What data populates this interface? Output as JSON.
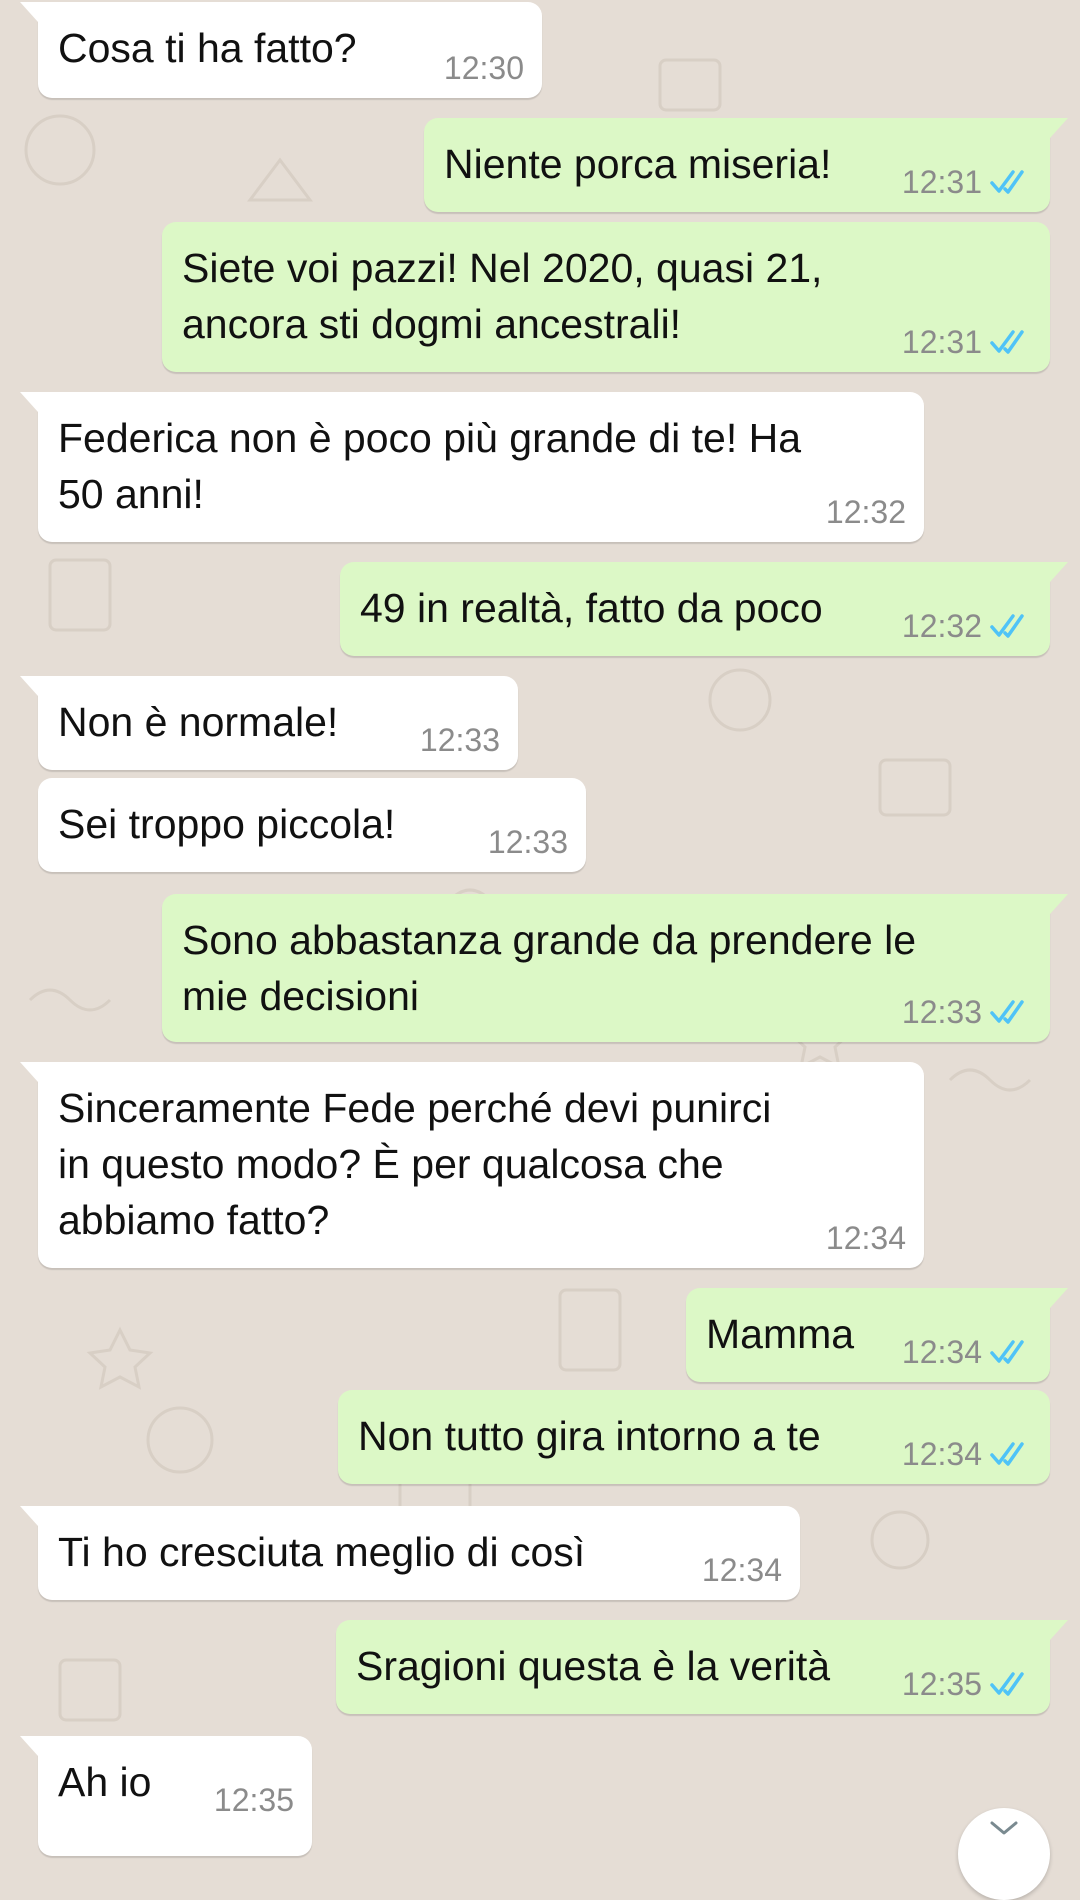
{
  "colors": {
    "background": "#e5ddd5",
    "incoming_bubble": "#ffffff",
    "outgoing_bubble": "#dcf8c6",
    "read_ticks": "#4fc3f7",
    "time_text": "#8b8b8b"
  },
  "messages": [
    {
      "dir": "in",
      "lines": [
        "Cosa ti ha fatto?"
      ],
      "time": "12:30"
    },
    {
      "dir": "out",
      "lines": [
        "Niente porca miseria!"
      ],
      "time": "12:31",
      "status": "read"
    },
    {
      "dir": "out",
      "lines": [
        "Siete voi pazzi! Nel 2020, quasi 21,",
        "ancora sti dogmi ancestrali!"
      ],
      "time": "12:31",
      "status": "read"
    },
    {
      "dir": "in",
      "lines": [
        "Federica non è poco più grande di te! Ha",
        "50 anni!"
      ],
      "time": "12:32"
    },
    {
      "dir": "out",
      "lines": [
        "49 in realtà, fatto da poco"
      ],
      "time": "12:32",
      "status": "read"
    },
    {
      "dir": "in",
      "lines": [
        "Non è normale!"
      ],
      "time": "12:33"
    },
    {
      "dir": "in",
      "lines": [
        "Sei troppo piccola!"
      ],
      "time": "12:33"
    },
    {
      "dir": "out",
      "lines": [
        "Sono abbastanza grande da prendere le",
        "mie decisioni"
      ],
      "time": "12:33",
      "status": "read"
    },
    {
      "dir": "in",
      "lines": [
        "Sinceramente Fede perché devi punirci",
        "in questo modo? È per qualcosa che",
        "abbiamo fatto?"
      ],
      "time": "12:34"
    },
    {
      "dir": "out",
      "lines": [
        "Mamma"
      ],
      "time": "12:34",
      "status": "read"
    },
    {
      "dir": "out",
      "lines": [
        "Non tutto gira intorno a te"
      ],
      "time": "12:34",
      "status": "read"
    },
    {
      "dir": "in",
      "lines": [
        "Ti ho cresciuta meglio di così"
      ],
      "time": "12:34"
    },
    {
      "dir": "out",
      "lines": [
        "Sragioni questa è la verità"
      ],
      "time": "12:35",
      "status": "read"
    },
    {
      "dir": "in",
      "lines": [
        "Ah io"
      ],
      "time": "12:35"
    }
  ],
  "icons": {
    "read_receipt": "double-check-icon",
    "scroll_down": "chevron-down-icon"
  }
}
